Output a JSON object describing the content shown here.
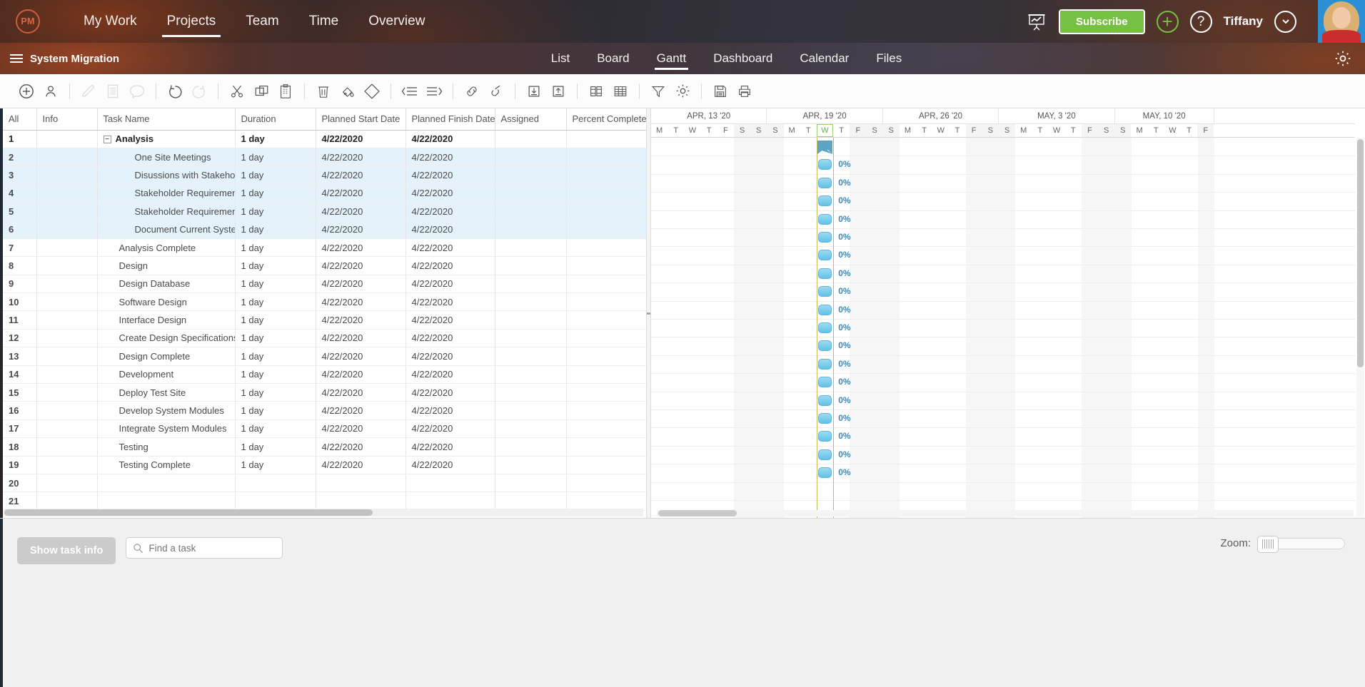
{
  "topnav": {
    "logo": "PM",
    "items": [
      {
        "label": "My Work",
        "active": false
      },
      {
        "label": "Projects",
        "active": true
      },
      {
        "label": "Team",
        "active": false
      },
      {
        "label": "Time",
        "active": false
      },
      {
        "label": "Overview",
        "active": false
      }
    ],
    "presentation_icon": "presentation-chart-icon",
    "subscribe_label": "Subscribe",
    "add_icon": "plus-circle-icon",
    "help_icon": "question-circle-icon",
    "username": "Tiffany",
    "chevron_icon": "chevron-down-circle-icon",
    "avatar": "user-avatar"
  },
  "projectbar": {
    "menu_icon": "hamburger-icon",
    "project_name": "System Migration",
    "tabs": [
      {
        "label": "List",
        "active": false
      },
      {
        "label": "Board",
        "active": false
      },
      {
        "label": "Gantt",
        "active": true
      },
      {
        "label": "Dashboard",
        "active": false
      },
      {
        "label": "Calendar",
        "active": false
      },
      {
        "label": "Files",
        "active": false
      }
    ],
    "settings_icon": "gear-icon"
  },
  "toolbar": {
    "groups": [
      [
        "add-task-icon",
        "assign-resource-icon"
      ],
      [
        "edit-pencil-icon",
        "notes-icon",
        "comment-icon"
      ],
      [
        "undo-icon",
        "redo-icon"
      ],
      [
        "cut-icon",
        "copy-icon",
        "paste-icon"
      ],
      [
        "delete-trash-icon",
        "fill-color-icon",
        "milestone-diamond-icon"
      ],
      [
        "outdent-icon",
        "indent-icon"
      ],
      [
        "link-tasks-icon",
        "unlink-tasks-icon"
      ],
      [
        "import-icon",
        "export-icon"
      ],
      [
        "columns-icon",
        "table-grid-icon"
      ],
      [
        "filter-funnel-icon",
        "settings-gear-icon"
      ],
      [
        "save-icon",
        "print-icon"
      ]
    ]
  },
  "table": {
    "columns": [
      "All",
      "Info",
      "Task Name",
      "Duration",
      "Planned Start Date",
      "Planned Finish Date",
      "Assigned",
      "Percent Complete"
    ],
    "rows": [
      {
        "n": "1",
        "name": "Analysis",
        "indent": 0,
        "summary": true,
        "expander": "−",
        "duration": "1 day",
        "start": "4/22/2020",
        "finish": "4/22/2020",
        "assigned": "",
        "pct": "",
        "selected": false
      },
      {
        "n": "2",
        "name": "One Site Meetings",
        "indent": 2,
        "summary": false,
        "duration": "1 day",
        "start": "4/22/2020",
        "finish": "4/22/2020",
        "assigned": "",
        "pct": "",
        "selected": true
      },
      {
        "n": "3",
        "name": "Disussions with Stakehold",
        "indent": 2,
        "summary": false,
        "duration": "1 day",
        "start": "4/22/2020",
        "finish": "4/22/2020",
        "assigned": "",
        "pct": "",
        "selected": true
      },
      {
        "n": "4",
        "name": "Stakeholder Requirements",
        "indent": 2,
        "summary": false,
        "duration": "1 day",
        "start": "4/22/2020",
        "finish": "4/22/2020",
        "assigned": "",
        "pct": "",
        "selected": true
      },
      {
        "n": "5",
        "name": "Stakeholder Requirements",
        "indent": 2,
        "summary": false,
        "duration": "1 day",
        "start": "4/22/2020",
        "finish": "4/22/2020",
        "assigned": "",
        "pct": "",
        "selected": true
      },
      {
        "n": "6",
        "name": "Document Current System",
        "indent": 2,
        "summary": false,
        "duration": "1 day",
        "start": "4/22/2020",
        "finish": "4/22/2020",
        "assigned": "",
        "pct": "",
        "selected": true
      },
      {
        "n": "7",
        "name": "Analysis Complete",
        "indent": 1,
        "summary": false,
        "duration": "1 day",
        "start": "4/22/2020",
        "finish": "4/22/2020",
        "assigned": "",
        "pct": "",
        "selected": false
      },
      {
        "n": "8",
        "name": "Design",
        "indent": 1,
        "summary": false,
        "duration": "1 day",
        "start": "4/22/2020",
        "finish": "4/22/2020",
        "assigned": "",
        "pct": "",
        "selected": false
      },
      {
        "n": "9",
        "name": "Design Database",
        "indent": 1,
        "summary": false,
        "duration": "1 day",
        "start": "4/22/2020",
        "finish": "4/22/2020",
        "assigned": "",
        "pct": "",
        "selected": false
      },
      {
        "n": "10",
        "name": "Software Design",
        "indent": 1,
        "summary": false,
        "duration": "1 day",
        "start": "4/22/2020",
        "finish": "4/22/2020",
        "assigned": "",
        "pct": "",
        "selected": false
      },
      {
        "n": "11",
        "name": "Interface Design",
        "indent": 1,
        "summary": false,
        "duration": "1 day",
        "start": "4/22/2020",
        "finish": "4/22/2020",
        "assigned": "",
        "pct": "",
        "selected": false
      },
      {
        "n": "12",
        "name": "Create Design Specifications",
        "indent": 1,
        "summary": false,
        "duration": "1 day",
        "start": "4/22/2020",
        "finish": "4/22/2020",
        "assigned": "",
        "pct": "",
        "selected": false
      },
      {
        "n": "13",
        "name": "Design Complete",
        "indent": 1,
        "summary": false,
        "duration": "1 day",
        "start": "4/22/2020",
        "finish": "4/22/2020",
        "assigned": "",
        "pct": "",
        "selected": false
      },
      {
        "n": "14",
        "name": "Development",
        "indent": 1,
        "summary": false,
        "duration": "1 day",
        "start": "4/22/2020",
        "finish": "4/22/2020",
        "assigned": "",
        "pct": "",
        "selected": false
      },
      {
        "n": "15",
        "name": "Deploy Test Site",
        "indent": 1,
        "summary": false,
        "duration": "1 day",
        "start": "4/22/2020",
        "finish": "4/22/2020",
        "assigned": "",
        "pct": "",
        "selected": false
      },
      {
        "n": "16",
        "name": "Develop System Modules",
        "indent": 1,
        "summary": false,
        "duration": "1 day",
        "start": "4/22/2020",
        "finish": "4/22/2020",
        "assigned": "",
        "pct": "",
        "selected": false
      },
      {
        "n": "17",
        "name": "Integrate System Modules",
        "indent": 1,
        "summary": false,
        "duration": "1 day",
        "start": "4/22/2020",
        "finish": "4/22/2020",
        "assigned": "",
        "pct": "",
        "selected": false
      },
      {
        "n": "18",
        "name": "Testing",
        "indent": 1,
        "summary": false,
        "duration": "1 day",
        "start": "4/22/2020",
        "finish": "4/22/2020",
        "assigned": "",
        "pct": "",
        "selected": false
      },
      {
        "n": "19",
        "name": "Testing Complete",
        "indent": 1,
        "summary": false,
        "duration": "1 day",
        "start": "4/22/2020",
        "finish": "4/22/2020",
        "assigned": "",
        "pct": "",
        "selected": false
      },
      {
        "n": "20",
        "name": "",
        "indent": 0,
        "summary": false,
        "duration": "",
        "start": "",
        "finish": "",
        "assigned": "",
        "pct": "",
        "selected": false
      },
      {
        "n": "21",
        "name": "",
        "indent": 0,
        "summary": false,
        "duration": "",
        "start": "",
        "finish": "",
        "assigned": "",
        "pct": "",
        "selected": false
      }
    ]
  },
  "gantt": {
    "weeks": [
      {
        "label": "APR, 13 '20",
        "days": [
          "M",
          "T",
          "W",
          "T",
          "F",
          "S",
          "S"
        ]
      },
      {
        "label": "APR, 19 '20",
        "days": [
          "S",
          "M",
          "T",
          "W",
          "T",
          "F",
          "S"
        ]
      },
      {
        "label": "APR, 26 '20",
        "days": [
          "S",
          "M",
          "T",
          "W",
          "T",
          "F",
          "S"
        ]
      },
      {
        "label": "MAY, 3 '20",
        "days": [
          "S",
          "M",
          "T",
          "W",
          "T",
          "F",
          "S"
        ]
      },
      {
        "label": "MAY, 10 '20",
        "days": [
          "S",
          "M",
          "T",
          "W",
          "T",
          "F"
        ]
      }
    ],
    "today_index": 10,
    "weekend_indices": [
      5,
      6,
      7,
      12,
      13,
      14,
      19,
      20,
      21,
      26,
      27,
      28,
      33,
      34
    ],
    "bars": [
      {
        "row": 0,
        "col": 10,
        "type": "summary",
        "pct": ""
      },
      {
        "row": 1,
        "col": 10,
        "type": "task",
        "pct": "0%"
      },
      {
        "row": 2,
        "col": 10,
        "type": "task",
        "pct": "0%"
      },
      {
        "row": 3,
        "col": 10,
        "type": "task",
        "pct": "0%"
      },
      {
        "row": 4,
        "col": 10,
        "type": "task",
        "pct": "0%"
      },
      {
        "row": 5,
        "col": 10,
        "type": "task",
        "pct": "0%"
      },
      {
        "row": 6,
        "col": 10,
        "type": "task",
        "pct": "0%"
      },
      {
        "row": 7,
        "col": 10,
        "type": "task",
        "pct": "0%"
      },
      {
        "row": 8,
        "col": 10,
        "type": "task",
        "pct": "0%"
      },
      {
        "row": 9,
        "col": 10,
        "type": "task",
        "pct": "0%"
      },
      {
        "row": 10,
        "col": 10,
        "type": "task",
        "pct": "0%"
      },
      {
        "row": 11,
        "col": 10,
        "type": "task",
        "pct": "0%"
      },
      {
        "row": 12,
        "col": 10,
        "type": "task",
        "pct": "0%"
      },
      {
        "row": 13,
        "col": 10,
        "type": "task",
        "pct": "0%"
      },
      {
        "row": 14,
        "col": 10,
        "type": "task",
        "pct": "0%"
      },
      {
        "row": 15,
        "col": 10,
        "type": "task",
        "pct": "0%"
      },
      {
        "row": 16,
        "col": 10,
        "type": "task",
        "pct": "0%"
      },
      {
        "row": 17,
        "col": 10,
        "type": "task",
        "pct": "0%"
      },
      {
        "row": 18,
        "col": 10,
        "type": "task",
        "pct": "0%"
      }
    ]
  },
  "footer": {
    "show_task_info_label": "Show task info",
    "search_icon": "search-icon",
    "search_placeholder": "Find a task",
    "search_value": "",
    "zoom_label": "Zoom:"
  },
  "colors": {
    "accent_green": "#76c043",
    "brand_orange": "#cf5c3b",
    "bar_blue": "#63c1e8",
    "summary_blue": "#5ba4c4",
    "selection_blue": "#e3f2fb",
    "today_line": "#c7b65a"
  }
}
